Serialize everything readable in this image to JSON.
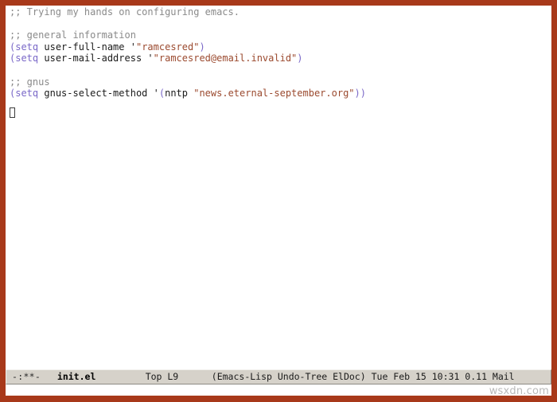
{
  "window": {
    "app": "GNU Emacs",
    "border_color": "#a8391a",
    "background": "#ffffff"
  },
  "buffer": {
    "name": "init.el",
    "major_mode": "Emacs-Lisp",
    "lines": [
      {
        "n": 1,
        "text": ";; Trying my hands on configuring emacs.",
        "tokens": [
          {
            "t": ";; Trying my hands on configuring emacs.",
            "c": "comment"
          }
        ]
      },
      {
        "n": 2,
        "text": "",
        "tokens": []
      },
      {
        "n": 3,
        "text": ";; general information",
        "tokens": [
          {
            "t": ";; general information",
            "c": "comment"
          }
        ]
      },
      {
        "n": 4,
        "text": "(setq user-full-name '\"ramcesred\")",
        "tokens": [
          {
            "t": "(",
            "c": "paren"
          },
          {
            "t": "setq",
            "c": "keyword"
          },
          {
            "t": " user-full-name ",
            "c": "symbol"
          },
          {
            "t": "'",
            "c": "quote"
          },
          {
            "t": "\"ramcesred\"",
            "c": "string"
          },
          {
            "t": ")",
            "c": "paren"
          }
        ]
      },
      {
        "n": 5,
        "text": "(setq user-mail-address '\"ramcesred@email.invalid\")",
        "tokens": [
          {
            "t": "(",
            "c": "paren"
          },
          {
            "t": "setq",
            "c": "keyword"
          },
          {
            "t": " user-mail-address ",
            "c": "symbol"
          },
          {
            "t": "'",
            "c": "quote"
          },
          {
            "t": "\"ramcesred@email.invalid\"",
            "c": "string"
          },
          {
            "t": ")",
            "c": "paren"
          }
        ]
      },
      {
        "n": 6,
        "text": "",
        "tokens": []
      },
      {
        "n": 7,
        "text": ";; gnus",
        "tokens": [
          {
            "t": ";; gnus",
            "c": "comment"
          }
        ]
      },
      {
        "n": 8,
        "text": "(setq gnus-select-method '(nntp \"news.eternal-september.org\"))",
        "tokens": [
          {
            "t": "(",
            "c": "paren"
          },
          {
            "t": "setq",
            "c": "keyword"
          },
          {
            "t": " gnus-select-method ",
            "c": "symbol"
          },
          {
            "t": "'",
            "c": "quote"
          },
          {
            "t": "(",
            "c": "paren"
          },
          {
            "t": "nntp ",
            "c": "symbol"
          },
          {
            "t": "\"news.eternal-september.org\"",
            "c": "string"
          },
          {
            "t": "))",
            "c": "paren"
          }
        ]
      },
      {
        "n": 9,
        "text": "",
        "tokens": []
      }
    ]
  },
  "syntax_colors": {
    "comment": "#8a8a8a",
    "paren": "#7a68c8",
    "keyword": "#7a68c8",
    "symbol": "#1a1a1a",
    "string": "#9b4a2f",
    "quote": "#1a1a1a",
    "default": "#000000"
  },
  "cursor": {
    "style": "hollow-box",
    "line": 9,
    "column": 1
  },
  "mode_line": {
    "flags": "-:**-",
    "buffer_name": "init.el",
    "position": "Top L9",
    "modes": "(Emacs-Lisp Undo-Tree ElDoc)",
    "day": "Tue",
    "month": "Feb",
    "date": "15",
    "time": "10:31",
    "load_average": "0.11",
    "mail": "Mail",
    "full": "-:**-   init.el        Top L9     (Emacs-Lisp Undo-Tree ElDoc) Tue Feb 15 10:31 0.11 Mail",
    "background": "#d6d2ca"
  },
  "minibuffer": {
    "text": ""
  },
  "watermark": {
    "text": "wsxdn.com"
  }
}
